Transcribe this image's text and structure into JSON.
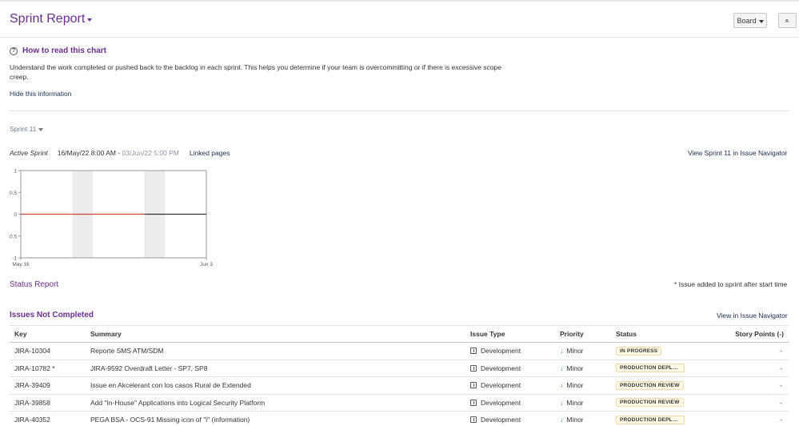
{
  "header": {
    "title": "Sprint Report",
    "board_label": "Board",
    "collapse_glyph": "«"
  },
  "help": {
    "icon": "?",
    "title": "How to read this chart",
    "text": "Understand the work completed or pushed back to the backlog in each sprint. This helps you determine if your team is overcommitting or if there is excessive scope creep.",
    "hide_label": "Hide this information"
  },
  "sprint": {
    "selected": "Sprint 11",
    "state": "Active Sprint",
    "start": "16/May/22 8:00 AM",
    "separator": " - ",
    "end": "03/Jun/22 5:00 PM",
    "linked_pages": "Linked pages",
    "view_in_navigator": "View Sprint 11 in Issue Navigator"
  },
  "chart_data": {
    "type": "line",
    "x": [
      "May 16",
      "Jun 3"
    ],
    "ylim": [
      -1,
      1
    ],
    "yticks": [
      "1",
      "0.5",
      "0",
      "0.5",
      "-1"
    ],
    "xticks": [
      "May 16",
      "Jun 3"
    ],
    "series": [
      {
        "values": [
          0,
          0
        ],
        "color": "#d04437",
        "x_range": [
          "May 16",
          "May 28"
        ]
      },
      {
        "values": [
          0,
          0
        ],
        "color": "#333333",
        "x_range": [
          "May 28",
          "Jun 3"
        ]
      }
    ],
    "shaded_columns": [
      [
        "May 21",
        "May 23"
      ],
      [
        "May 28",
        "May 30"
      ]
    ],
    "grid": false
  },
  "status_report": {
    "title": "Status Report",
    "footnote": "* Issue added to sprint after start time"
  },
  "issues_not_completed": {
    "title": "Issues Not Completed",
    "view_link": "View in Issue Navigator",
    "columns": [
      "Key",
      "Summary",
      "Issue Type",
      "Priority",
      "Status",
      "Story Points (-)"
    ],
    "rows": [
      {
        "key": "JIRA-10304",
        "summary": "Reporte SMS ATM/SDM",
        "type": "Development",
        "priority": "Minor",
        "status": "IN PROGRESS",
        "points": "-"
      },
      {
        "key": "JIRA-10782 *",
        "summary": "JIRA-9592 Overdraft Letter - SP7, SP8",
        "type": "Development",
        "priority": "Minor",
        "status": "PRODUCTION DEPLO...",
        "points": "-"
      },
      {
        "key": "JIRA-39409",
        "summary": "Issue en Akcelerant con los casos Rural de Extended",
        "type": "Development",
        "priority": "Minor",
        "status": "PRODUCTION REVIEW",
        "points": "-"
      },
      {
        "key": "JIRA-39858",
        "summary": "Add \"In-House\" Applications into Logical Security Platform",
        "type": "Development",
        "priority": "Minor",
        "status": "PRODUCTION REVIEW",
        "points": "-"
      },
      {
        "key": "JIRA-40352",
        "summary": "PEGA BSA - OCS-91 Missing icon of \"i\" (information)",
        "type": "Development",
        "priority": "Minor",
        "status": "PRODUCTION DEPLO...",
        "points": "-"
      }
    ]
  },
  "colors": {
    "brand": "#6d2d8f",
    "guideline": "#d04437",
    "priority_minor": "#2e8b3c"
  }
}
